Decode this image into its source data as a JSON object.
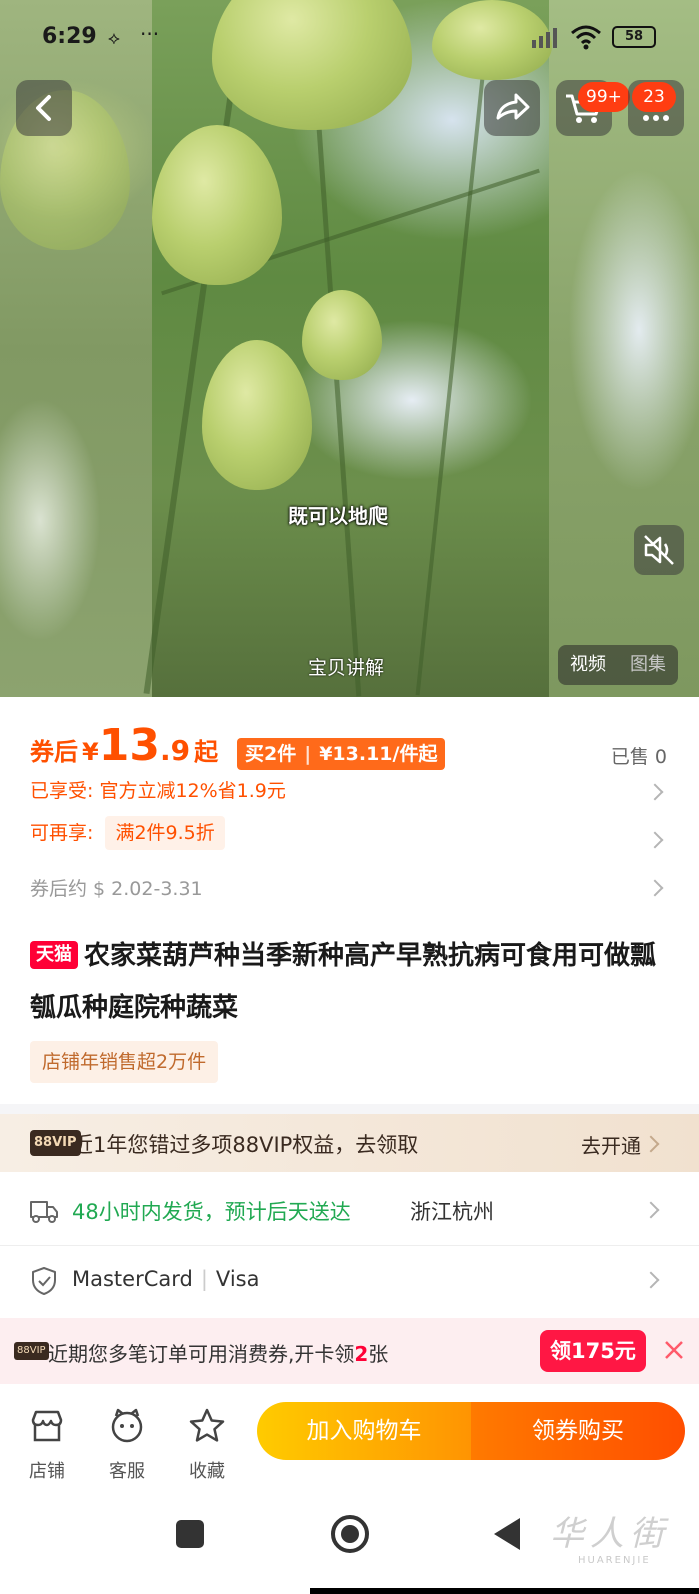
{
  "status_bar": {
    "time": "6:29",
    "battery": "58"
  },
  "toolbar": {
    "cart_badge": "99+",
    "msg_badge": "23"
  },
  "media": {
    "subtitle": "既可以地爬",
    "explain_label": "宝贝讲解",
    "tabs": [
      {
        "label": "视频",
        "active": true
      },
      {
        "label": "图集",
        "active": false
      }
    ]
  },
  "price": {
    "prefix": "券后",
    "currency": "¥",
    "integer": "13",
    "decimal": ".9",
    "suffix": "起",
    "multi_buy_qty": "买2件",
    "multi_buy_price": "¥13.11/件起",
    "sold": "已售 0"
  },
  "discounts": {
    "enjoyed": "已享受: 官方立减12%省1.9元",
    "more_label": "可再享:",
    "more_tag": "满2件9.5折",
    "converted": "券后约 $ 2.02-3.31"
  },
  "product": {
    "platform_tag": "天猫",
    "title": "农家菜葫芦种当季新种高产早熟抗病可食用可做瓢瓠瓜种庭院种蔬菜",
    "store_sales": "店铺年销售超2万件"
  },
  "vip": {
    "logo": "88VIP",
    "text": "近1年您错过多项88VIP权益，去领取",
    "action": "去开通"
  },
  "shipping": {
    "text": "48小时内发货，预计后天送达",
    "location": "浙江杭州"
  },
  "payment": {
    "methods": [
      "MasterCard",
      "Visa"
    ]
  },
  "promo": {
    "logo": "88VIP",
    "text_before": "近期您多笔订单可用消费券,开卡领",
    "text_count": "2",
    "text_after": "张",
    "cta": "领175元"
  },
  "bottom_bar": {
    "store": "店铺",
    "service": "客服",
    "favorite": "收藏",
    "add_to_cart": "加入购物车",
    "buy": "领券购买"
  },
  "watermark": {
    "zh": "华人街",
    "en": "HUARENJIE"
  },
  "colors": {
    "accent": "#ff5000",
    "tmall": "#ff0036",
    "ship_green": "#21a952"
  }
}
